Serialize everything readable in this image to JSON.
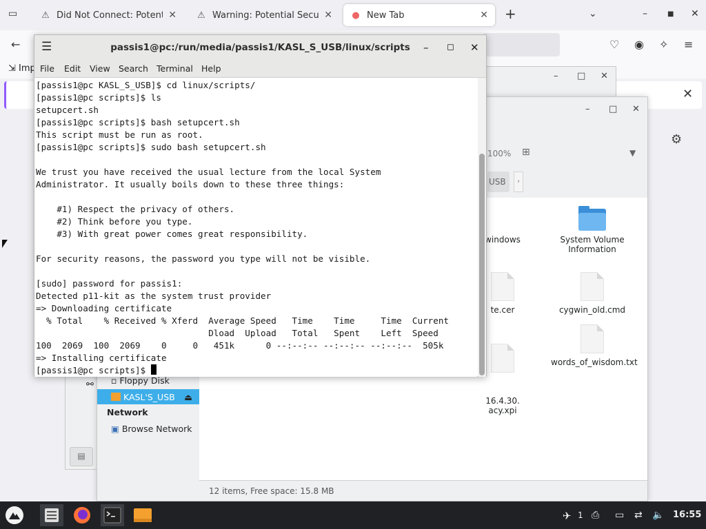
{
  "browser": {
    "tabs": [
      {
        "title": "Did Not Connect: Potential Se",
        "icon": "warning-icon"
      },
      {
        "title": "Warning: Potential Security R",
        "icon": "warning-icon"
      },
      {
        "title": "New Tab",
        "icon": "firefox-icon"
      }
    ],
    "bookmark_import": "Imp",
    "new_tab_symbol": "+",
    "close_symbol": "✕"
  },
  "file_manager": {
    "zoom": "100%",
    "breadcrumb": "USB",
    "places": {
      "floppy": "Floppy Disk",
      "usb": "KASL'S_USB",
      "network_header": "Network",
      "browse_network": "Browse Network"
    },
    "files": [
      {
        "name": "windows",
        "type": "folder"
      },
      {
        "name": "System Volume Information",
        "type": "folder"
      },
      {
        "name": "te.cer",
        "type": "file"
      },
      {
        "name": "cygwin_old.cmd",
        "type": "file"
      },
      {
        "name": "16.4.30.\nacy.xpi",
        "type": "file"
      },
      {
        "name": "words_of_wisdom.txt",
        "type": "file"
      }
    ],
    "status": "12 items, Free space: 15.8 MB"
  },
  "terminal": {
    "title": "passis1@pc:/run/media/passis1/KASL_S_USB/linux/scripts",
    "menu": [
      "File",
      "Edit",
      "View",
      "Search",
      "Terminal",
      "Help"
    ],
    "lines": [
      "[passis1@pc KASL_S_USB]$ cd linux/scripts/",
      "[passis1@pc scripts]$ ls",
      "setupcert.sh",
      "[passis1@pc scripts]$ bash setupcert.sh",
      "This script must be run as root.",
      "[passis1@pc scripts]$ sudo bash setupcert.sh",
      "",
      "We trust you have received the usual lecture from the local System",
      "Administrator. It usually boils down to these three things:",
      "",
      "    #1) Respect the privacy of others.",
      "    #2) Think before you type.",
      "    #3) With great power comes great responsibility.",
      "",
      "For security reasons, the password you type will not be visible.",
      "",
      "[sudo] password for passis1:",
      "Detected p11-kit as the system trust provider",
      "=> Downloading certificate",
      "  % Total    % Received % Xferd  Average Speed   Time    Time     Time  Current",
      "                                 Dload  Upload   Total   Spent    Left  Speed",
      "100  2069  100  2069    0     0   451k      0 --:--:-- --:--:-- --:--:--  505k",
      "=> Installing certificate"
    ],
    "prompt": "[passis1@pc scripts]$ "
  },
  "taskbar": {
    "notification_count": "1",
    "clock": "16:55"
  },
  "colors": {
    "selection": "#3daee9",
    "taskbar": "#1f2124",
    "firefox_accent": "#9059ff"
  }
}
